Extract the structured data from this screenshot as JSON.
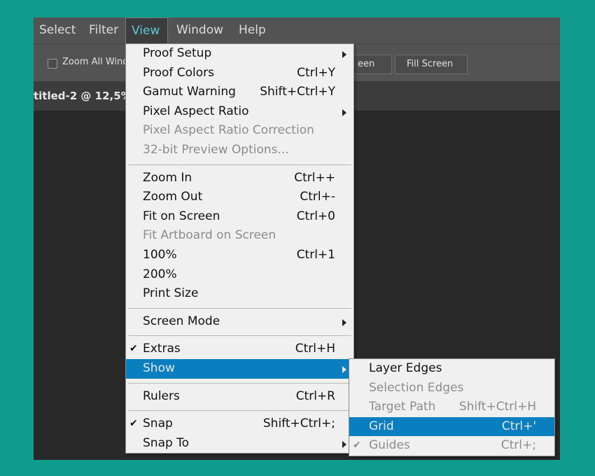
{
  "menubar": {
    "items": [
      {
        "label": "Select"
      },
      {
        "label": "Filter"
      },
      {
        "label": "View"
      },
      {
        "label": "Window"
      },
      {
        "label": "Help"
      }
    ]
  },
  "options": {
    "zoom_all_label": "Zoom All Wind",
    "screen_btn": "een",
    "fill_screen_btn": "Fill Screen"
  },
  "document": {
    "tab_label": "titled-2 @ 12,5% ("
  },
  "view_menu": {
    "items": [
      {
        "label": "Proof Setup",
        "shortcut": "",
        "submenu": true
      },
      {
        "label": "Proof Colors",
        "shortcut": "Ctrl+Y"
      },
      {
        "label": "Gamut Warning",
        "shortcut": "Shift+Ctrl+Y"
      },
      {
        "label": "Pixel Aspect Ratio",
        "shortcut": "",
        "submenu": true
      },
      {
        "label": "Pixel Aspect Ratio Correction",
        "shortcut": "",
        "disabled": true
      },
      {
        "label": "32-bit Preview Options...",
        "shortcut": "",
        "disabled": true
      },
      {
        "label": "Zoom In",
        "shortcut": "Ctrl++"
      },
      {
        "label": "Zoom Out",
        "shortcut": "Ctrl+-"
      },
      {
        "label": "Fit on Screen",
        "shortcut": "Ctrl+0"
      },
      {
        "label": "Fit Artboard on Screen",
        "shortcut": "",
        "disabled": true
      },
      {
        "label": "100%",
        "shortcut": "Ctrl+1"
      },
      {
        "label": "200%",
        "shortcut": ""
      },
      {
        "label": "Print Size",
        "shortcut": ""
      },
      {
        "label": "Screen Mode",
        "shortcut": "",
        "submenu": true
      },
      {
        "label": "Extras",
        "shortcut": "Ctrl+H",
        "checked": true
      },
      {
        "label": "Show",
        "shortcut": "",
        "submenu": true,
        "highlight": true
      },
      {
        "label": "Rulers",
        "shortcut": "Ctrl+R"
      },
      {
        "label": "Snap",
        "shortcut": "Shift+Ctrl+;",
        "checked": true
      },
      {
        "label": "Snap To",
        "shortcut": "",
        "submenu": true
      }
    ]
  },
  "show_menu": {
    "items": [
      {
        "label": "Layer Edges",
        "shortcut": ""
      },
      {
        "label": "Selection Edges",
        "shortcut": "",
        "disabled": true
      },
      {
        "label": "Target Path",
        "shortcut": "Shift+Ctrl+H",
        "disabled": true
      },
      {
        "label": "Grid",
        "shortcut": "Ctrl+'",
        "highlight": true
      },
      {
        "label": "Guides",
        "shortcut": "Ctrl+;",
        "checked": true,
        "disabled": true
      }
    ]
  },
  "colors": {
    "background": "#0f9b8e",
    "highlight": "#0a7fbf",
    "menu_bg": "#f0f0f0"
  }
}
